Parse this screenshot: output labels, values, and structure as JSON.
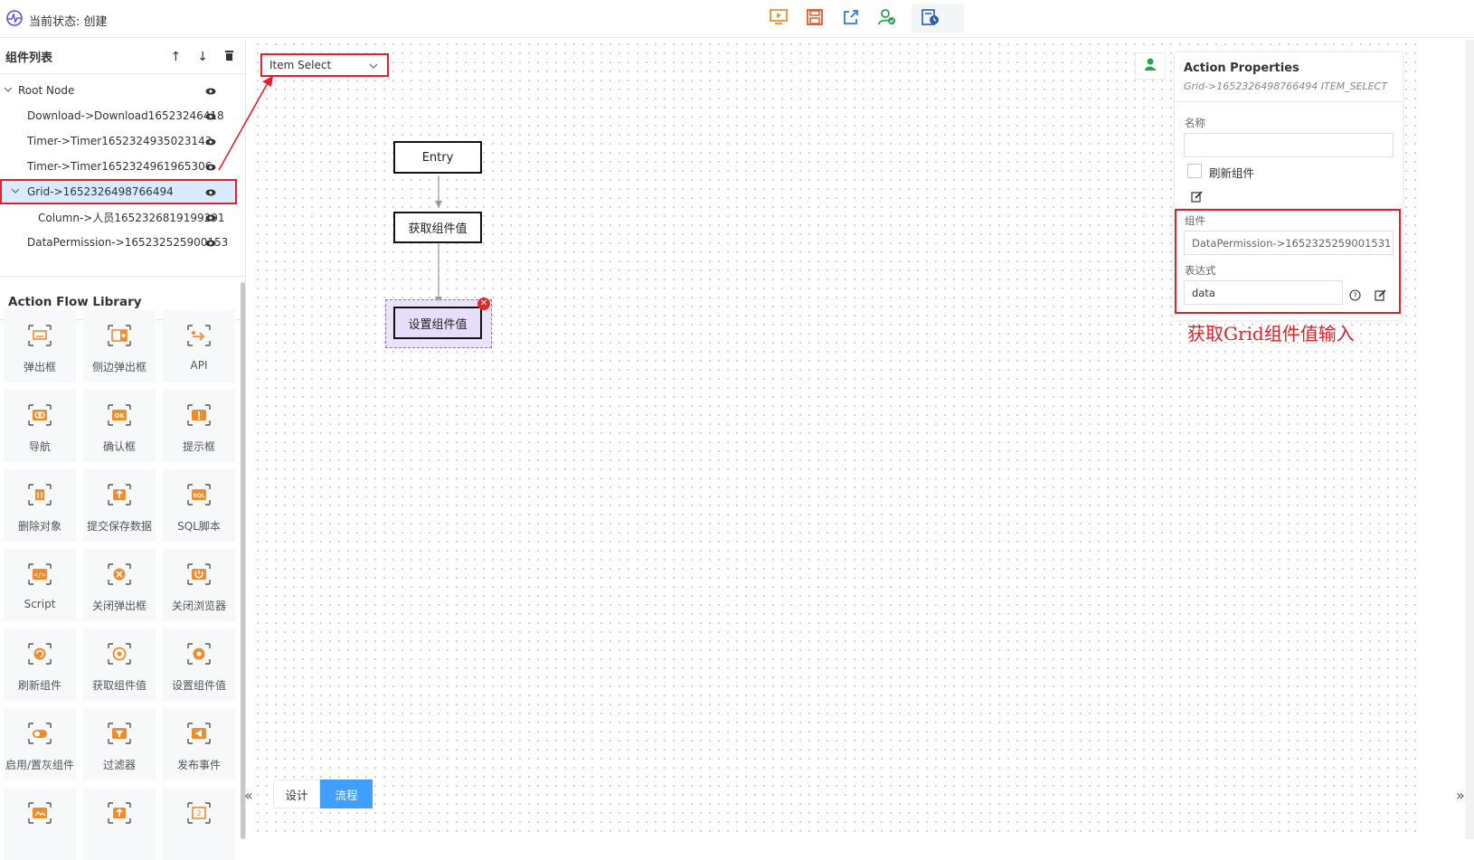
{
  "header": {
    "status_text": "当前状态: 创建",
    "toolbar": [
      "preview-icon",
      "save-icon",
      "export-icon",
      "publish-icon",
      "history-icon"
    ]
  },
  "component_list": {
    "title": "组件列表",
    "items": [
      {
        "label": "Root Node",
        "level": 0,
        "expanded": true,
        "selected": false
      },
      {
        "label": "Download->Download16523246418",
        "level": 1,
        "expanded": false,
        "selected": false
      },
      {
        "label": "Timer->Timer1652324935023143",
        "level": 1,
        "expanded": false,
        "selected": false
      },
      {
        "label": "Timer->Timer1652324961965306",
        "level": 1,
        "expanded": false,
        "selected": false
      },
      {
        "label": "Grid->1652326498766494",
        "level": 1,
        "expanded": true,
        "selected": true
      },
      {
        "label": "Column->人员1652326819199291",
        "level": 2,
        "expanded": false,
        "selected": false
      },
      {
        "label": "DataPermission->165232525900153",
        "level": 1,
        "expanded": false,
        "selected": false
      }
    ]
  },
  "library": {
    "title": "Action Flow Library",
    "items": [
      {
        "label": "弹出框",
        "icon": "popup-icon"
      },
      {
        "label": "侧边弹出框",
        "icon": "side-popup-icon"
      },
      {
        "label": "API",
        "icon": "api-icon"
      },
      {
        "label": "导航",
        "icon": "navigate-icon"
      },
      {
        "label": "确认框",
        "icon": "confirm-icon"
      },
      {
        "label": "提示框",
        "icon": "alert-icon"
      },
      {
        "label": "删除对象",
        "icon": "delete-object-icon"
      },
      {
        "label": "提交保存数据",
        "icon": "submit-save-icon"
      },
      {
        "label": "SQL脚本",
        "icon": "sql-icon"
      },
      {
        "label": "Script",
        "icon": "script-icon"
      },
      {
        "label": "关闭弹出框",
        "icon": "close-popup-icon"
      },
      {
        "label": "关闭浏览器",
        "icon": "close-browser-icon"
      },
      {
        "label": "刷新组件",
        "icon": "refresh-component-icon"
      },
      {
        "label": "获取组件值",
        "icon": "get-value-icon"
      },
      {
        "label": "设置组件值",
        "icon": "set-value-icon"
      },
      {
        "label": "启用/置灰组件",
        "icon": "toggle-component-icon"
      },
      {
        "label": "过滤器",
        "icon": "filter-icon"
      },
      {
        "label": "发布事件",
        "icon": "publish-event-icon"
      },
      {
        "label": "",
        "icon": "image-icon"
      },
      {
        "label": "",
        "icon": "upload-icon"
      },
      {
        "label": "",
        "icon": "branch-icon"
      }
    ]
  },
  "canvas": {
    "event_select": "Item Select",
    "nodes": [
      {
        "label": "Entry"
      },
      {
        "label": "获取组件值"
      },
      {
        "label": "设置组件值"
      }
    ],
    "tabs": {
      "design": "设计",
      "flow": "流程",
      "active": "flow"
    }
  },
  "properties": {
    "title": "Action Properties",
    "subtitle": "Grid->1652326498766494 ITEM_SELECT",
    "name_label": "名称",
    "name_value": "",
    "refresh_label": "刷新组件",
    "refresh_checked": false,
    "component_label": "组件",
    "component_value": "DataPermission->1652325259001531",
    "expression_label": "表达式",
    "expression_value": "data"
  },
  "annotation": "获取Grid组件值输入",
  "colors": {
    "accent": "#409eff",
    "highlight": "#e0202a",
    "icon_orange": "#f08c2b",
    "selected_row": "#d9ecff"
  }
}
